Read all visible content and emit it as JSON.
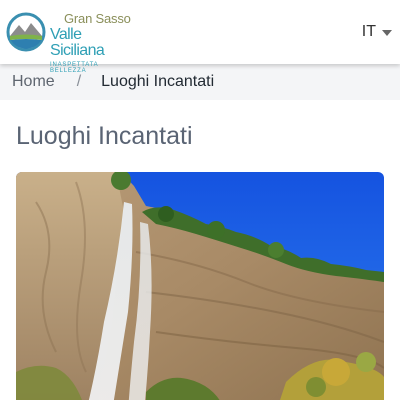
{
  "header": {
    "logo": {
      "line1": "Gran Sasso",
      "line2": "Valle Siciliana",
      "tagline": "INASPETTATA BELLEZZA"
    },
    "language": {
      "selected": "IT",
      "icon": "chevron-down-icon"
    }
  },
  "breadcrumb": {
    "home_label": "Home",
    "separator": "/",
    "current_label": "Luoghi Incantati"
  },
  "main": {
    "title": "Luoghi Incantati",
    "hero_image": "waterfall-cliff-photo"
  },
  "colors": {
    "title": "#5a6474",
    "breadcrumb_bg": "#f4f5f7",
    "logo_blue": "#2e9fb5",
    "logo_olive": "#8a8f5a"
  }
}
